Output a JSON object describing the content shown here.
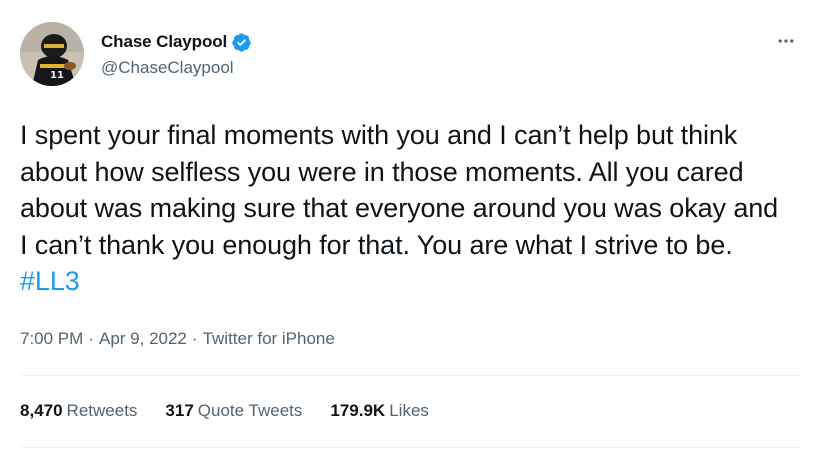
{
  "author": {
    "display_name": "Chase Claypool",
    "handle": "@ChaseClaypool",
    "verified": true
  },
  "tweet": {
    "text": "I spent your final moments with you and I can’t help but think about how selfless you were in those moments. All you cared about was making sure that everyone around you was okay and I can’t thank you enough for that. You are what I strive to be.",
    "hashtag": "#LL3",
    "time": "7:00 PM",
    "separator": "·",
    "date": "Apr 9, 2022",
    "source": "Twitter for iPhone"
  },
  "stats": {
    "retweets_count": "8,470",
    "retweets_label": "Retweets",
    "quotes_count": "317",
    "quotes_label": "Quote Tweets",
    "likes_count": "179.9K",
    "likes_label": "Likes"
  },
  "colors": {
    "text": "#0f1419",
    "secondary": "#536471",
    "accent": "#1d9bf0",
    "divider": "#eff3f4"
  },
  "icons": {
    "verified": "verified-badge-icon",
    "more": "more-options-icon"
  }
}
